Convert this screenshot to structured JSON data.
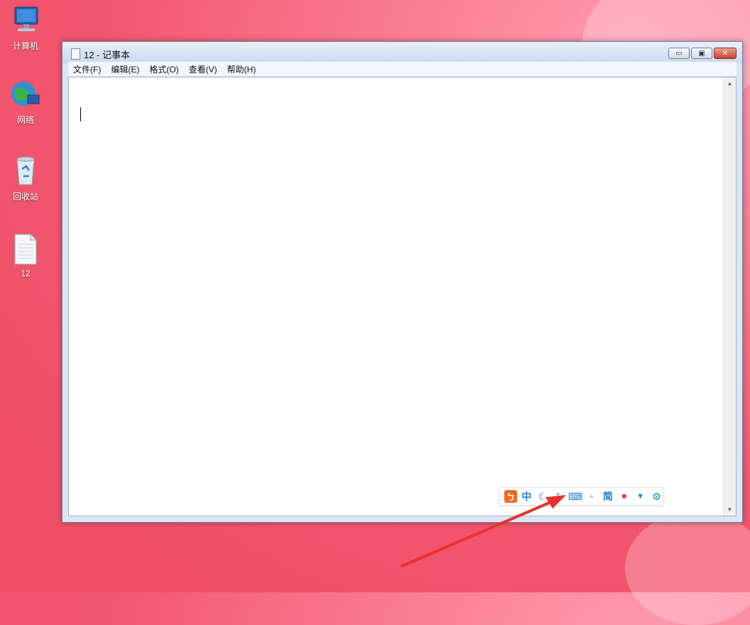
{
  "desktop": {
    "icons": [
      {
        "label": "计算机",
        "icon": "computer-icon"
      },
      {
        "label": "网络",
        "icon": "network-icon"
      },
      {
        "label": "回收站",
        "icon": "recycle-bin-icon"
      },
      {
        "label": "12",
        "icon": "text-file-icon"
      }
    ]
  },
  "window": {
    "title": "12 - 记事本",
    "menu": [
      "文件(F)",
      "编辑(E)",
      "格式(O)",
      "查看(V)",
      "帮助(H)"
    ],
    "buttons": {
      "minimize": "▭",
      "maximize": "▣",
      "close": "✕"
    },
    "editor_text": ""
  },
  "ime_toolbar": {
    "items": [
      {
        "icon": "sogou-logo-icon",
        "glyph": "ㄅ"
      },
      {
        "icon": "chinese-mode-icon",
        "glyph": "中"
      },
      {
        "icon": "moon-halfwidth-icon",
        "glyph": "☾"
      },
      {
        "icon": "punctuation-icon",
        "glyph": "°,"
      },
      {
        "icon": "keyboard-icon",
        "glyph": "⌨"
      },
      {
        "icon": "user-icon",
        "glyph": "●"
      },
      {
        "icon": "simplified-icon",
        "glyph": "简"
      },
      {
        "icon": "video-icon",
        "glyph": "■"
      },
      {
        "icon": "skin-shirt-icon",
        "glyph": "▼"
      },
      {
        "icon": "settings-gear-icon",
        "glyph": "⚙"
      }
    ]
  },
  "colors": {
    "desktop_pink": "#f2566e",
    "window_frame": "#dce6f3",
    "ime_blue": "#1e7fd6",
    "ime_orange": "#f26b1d",
    "arrow_red": "#e8322f"
  }
}
